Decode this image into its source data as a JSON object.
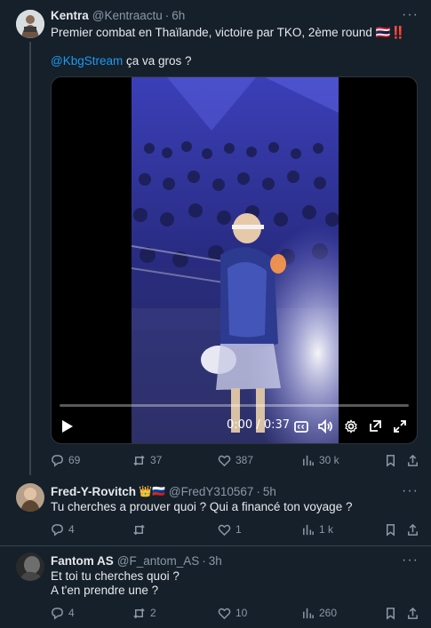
{
  "tweets": [
    {
      "name": "Kentra",
      "handle": "@Kentraactu",
      "time": "6h",
      "text_line1": "Premier combat en Thaïlande, victoire par TKO, 2ème round 🇹🇭‼️",
      "mention": "@KbgStream",
      "text_line2_rest": " ça va gros ?",
      "video": {
        "time_display": "0:00 / 0:37",
        "progress": 0.0
      },
      "actions": {
        "replies": "69",
        "reposts": "37",
        "likes": "387",
        "views": "30 k"
      }
    },
    {
      "name": "Fred-Y-Rovitch",
      "badges": "👑🇷🇺",
      "handle": "@FredY310567",
      "time": "5h",
      "text_line1": "Tu cherches a prouver quoi ? Qui a financé ton voyage ?",
      "actions": {
        "replies": "4",
        "reposts": "",
        "likes": "1",
        "views": "1 k"
      }
    },
    {
      "name": "Fantom AS",
      "handle": "@F_antom_AS",
      "time": "3h",
      "text_line1": "Et toi tu cherches quoi ?",
      "text_line2": "A t'en prendre une ?",
      "actions": {
        "replies": "4",
        "reposts": "2",
        "likes": "10",
        "views": "260"
      }
    }
  ],
  "icons": {
    "more": "more-icon",
    "reply": "reply-icon",
    "repost": "repost-icon",
    "like": "like-icon",
    "views": "views-icon",
    "bookmark": "bookmark-icon",
    "share": "share-icon"
  },
  "colors": {
    "background": "#15202b",
    "link": "#1d9bf0",
    "muted": "#8b98a5",
    "text": "#e7e9ea"
  }
}
